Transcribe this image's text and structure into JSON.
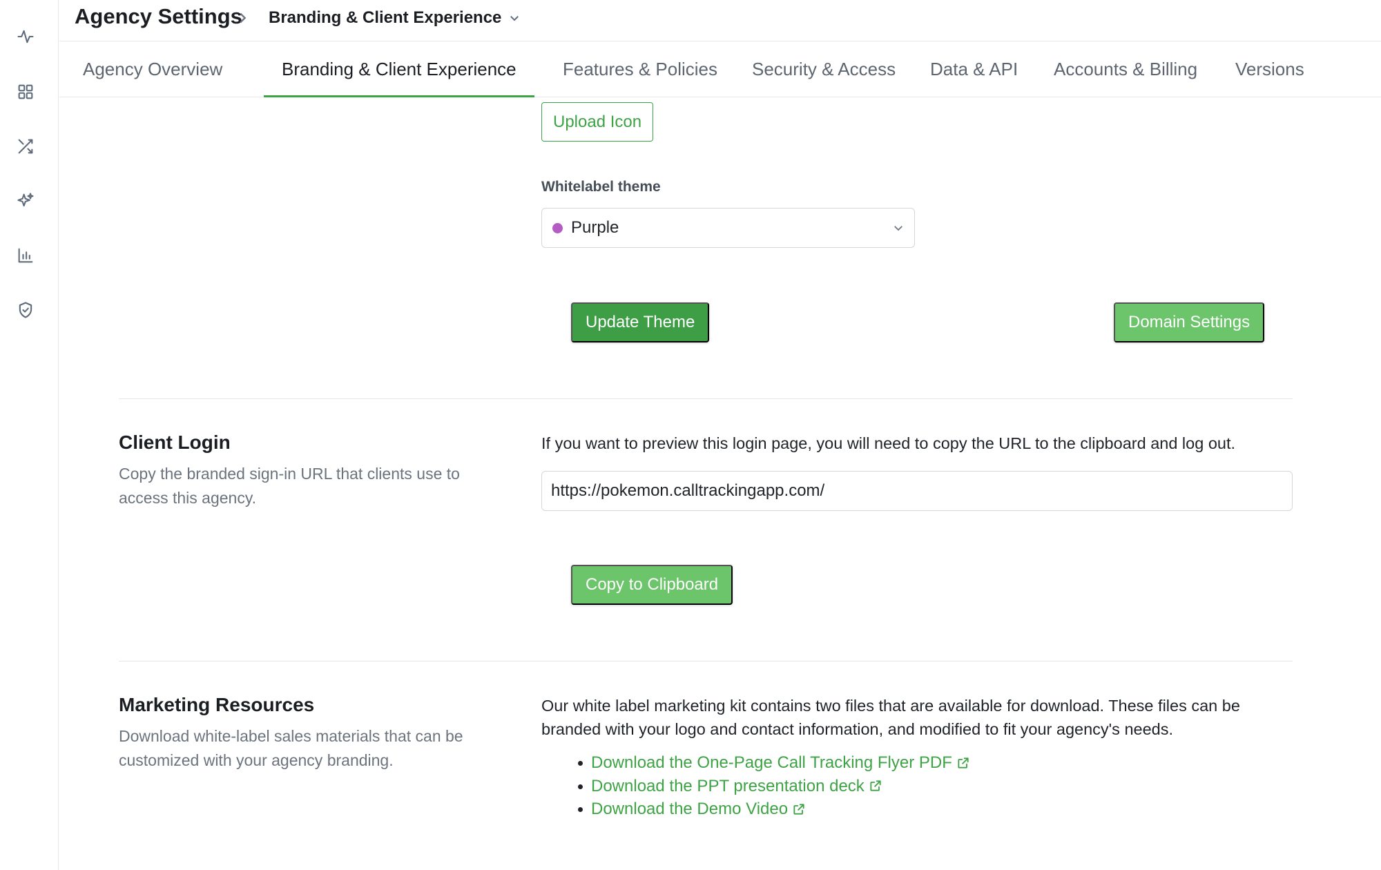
{
  "breadcrumb": {
    "root": "Agency Settings",
    "current": "Branding & Client Experience"
  },
  "sidebar_icons": [
    "activity-icon",
    "grid-icon",
    "shuffle-icon",
    "sparkles-icon",
    "bar-chart-icon",
    "shield-check-icon"
  ],
  "tabs": [
    {
      "label": "Agency Overview",
      "active": false
    },
    {
      "label": "Branding & Client Experience",
      "active": true
    },
    {
      "label": "Features & Policies",
      "active": false
    },
    {
      "label": "Security & Access",
      "active": false
    },
    {
      "label": "Data & API",
      "active": false
    },
    {
      "label": "Accounts & Billing",
      "active": false
    },
    {
      "label": "Versions",
      "active": false
    }
  ],
  "branding": {
    "upload_icon_label": "Upload Icon",
    "theme_label": "Whitelabel theme",
    "theme_value": "Purple",
    "theme_color": "#b45cc4",
    "update_theme_label": "Update Theme",
    "domain_settings_label": "Domain Settings"
  },
  "client_login": {
    "title": "Client Login",
    "description": "Copy the branded sign-in URL that clients use to access this agency.",
    "info": "If you want to preview this login page, you will need to copy the URL to the clipboard and log out.",
    "url": "https://pokemon.calltrackingapp.com/",
    "copy_label": "Copy to Clipboard"
  },
  "marketing": {
    "title": "Marketing Resources",
    "description": "Download white-label sales materials that can be customized with your agency branding.",
    "info": "Our white label marketing kit contains two files that are available for download. These files can be branded with your logo and contact information, and modified to fit your agency's needs.",
    "links": [
      "Download the One-Page Call Tracking Flyer PDF",
      "Download the PPT presentation deck",
      "Download the Demo Video"
    ]
  },
  "colors": {
    "accent": "#3da344",
    "button_primary": "#3e9e46",
    "button_secondary": "#6cc56a"
  }
}
